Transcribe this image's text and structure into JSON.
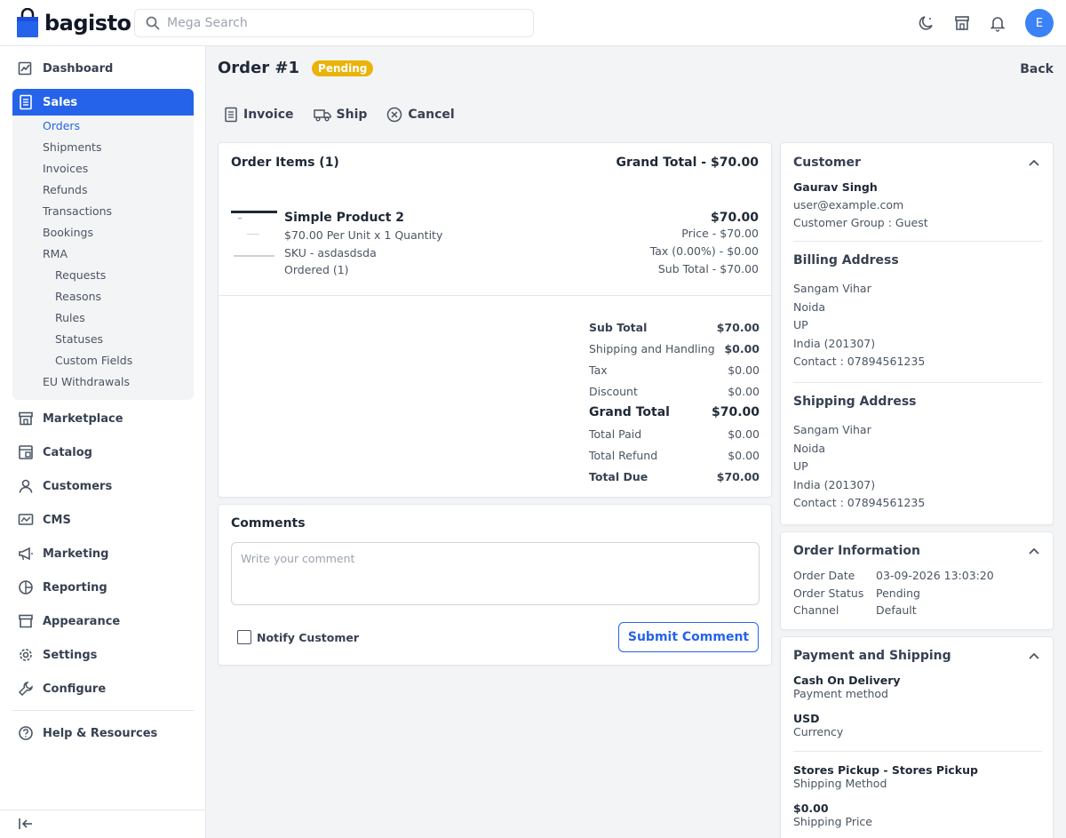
{
  "brand": {
    "name": "bagisto"
  },
  "header": {
    "search_placeholder": "Mega Search",
    "avatar_initial": "E"
  },
  "sidebar": {
    "dashboard": "Dashboard",
    "sales": "Sales",
    "sales_items": [
      "Orders",
      "Shipments",
      "Invoices",
      "Refunds",
      "Transactions",
      "Bookings",
      "RMA",
      "Requests",
      "Reasons",
      "Rules",
      "Statuses",
      "Custom Fields",
      "EU Withdrawals"
    ],
    "marketplace": "Marketplace",
    "catalog": "Catalog",
    "customers": "Customers",
    "cms": "CMS",
    "marketing": "Marketing",
    "reporting": "Reporting",
    "appearance": "Appearance",
    "settings": "Settings",
    "configure": "Configure",
    "help": "Help & Resources"
  },
  "page": {
    "title": "Order #1",
    "status_badge": "Pending",
    "back": "Back",
    "actions": {
      "invoice": "Invoice",
      "ship": "Ship",
      "cancel": "Cancel"
    }
  },
  "order_items": {
    "title": "Order Items (1)",
    "grand_total_label": "Grand Total - $70.00",
    "product": {
      "name": "Simple Product 2",
      "per_unit": "$70.00 Per Unit x 1 Quantity",
      "sku": "SKU - asdasdsda",
      "ordered": "Ordered (1)",
      "total": "$70.00",
      "price": "Price - $70.00",
      "tax": "Tax (0.00%) - $0.00",
      "subtotal": "Sub Total - $70.00"
    },
    "totals": {
      "sub_total_label": "Sub Total",
      "sub_total": "$70.00",
      "shipping_label": "Shipping and Handling",
      "shipping": "$0.00",
      "tax_label": "Tax",
      "tax": "$0.00",
      "discount_label": "Discount",
      "discount": "$0.00",
      "grand_total_label": "Grand Total",
      "grand_total": "$70.00",
      "total_paid_label": "Total Paid",
      "total_paid": "$0.00",
      "total_refund_label": "Total Refund",
      "total_refund": "$0.00",
      "total_due_label": "Total Due",
      "total_due": "$70.00"
    }
  },
  "comments": {
    "title": "Comments",
    "placeholder": "Write your comment",
    "notify_label": "Notify Customer",
    "submit": "Submit Comment"
  },
  "customer": {
    "title": "Customer",
    "name": "Gaurav Singh",
    "email": "user@example.com",
    "group": "Customer Group : Guest"
  },
  "billing": {
    "title": "Billing Address",
    "lines": [
      "Sangam Vihar",
      "Noida",
      "UP",
      "India (201307)",
      "Contact : 07894561235"
    ]
  },
  "shipping_address": {
    "title": "Shipping Address",
    "lines": [
      "Sangam Vihar",
      "Noida",
      "UP",
      "India (201307)",
      "Contact : 07894561235"
    ]
  },
  "order_info": {
    "title": "Order Information",
    "date_label": "Order Date",
    "date": "03-09-2026 13:03:20",
    "status_label": "Order Status",
    "status": "Pending",
    "channel_label": "Channel",
    "channel": "Default"
  },
  "payment_shipping": {
    "title": "Payment and Shipping",
    "payment_method": "Cash On Delivery",
    "payment_method_label": "Payment method",
    "currency": "USD",
    "currency_label": "Currency",
    "shipping_method": "Stores Pickup - Stores Pickup",
    "shipping_method_label": "Shipping Method",
    "shipping_price": "$0.00",
    "shipping_price_label": "Shipping Price"
  },
  "colors": {
    "accent": "#2563eb",
    "pending": "#eab308",
    "avatar": "#3b82f6"
  }
}
